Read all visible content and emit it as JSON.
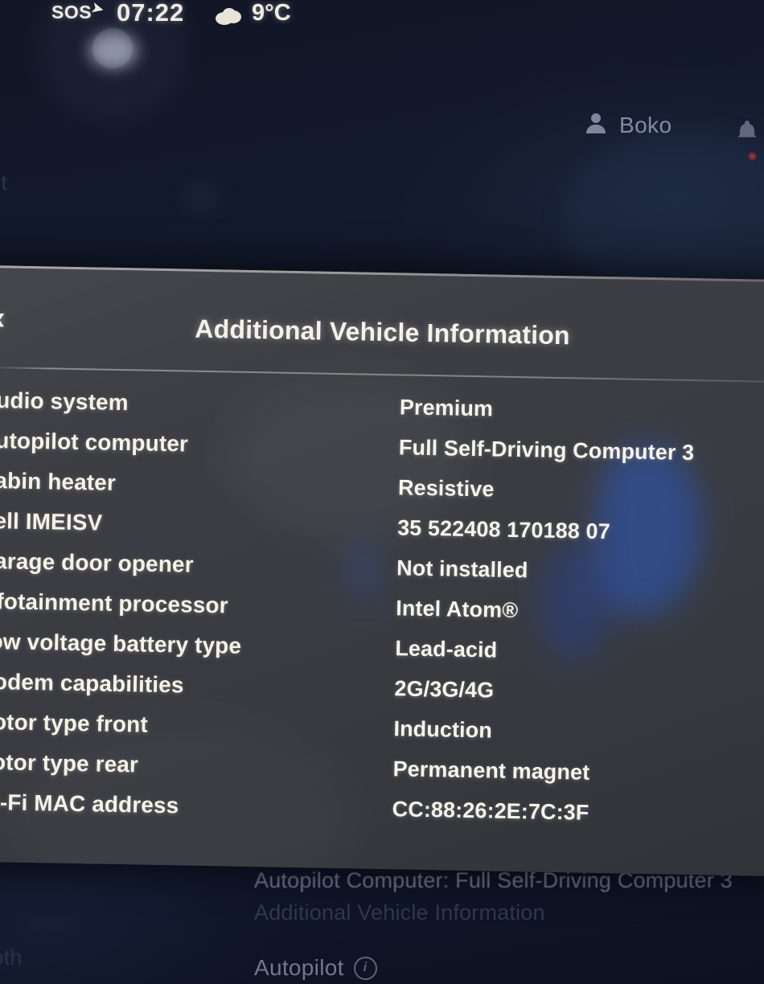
{
  "status_bar": {
    "sos_label": "SOS",
    "sos_arrow_icon": "call-arrow-icon",
    "time": "07:22",
    "weather_icon": "cloud-icon",
    "temperature": "9°C"
  },
  "profile": {
    "person_icon": "person-icon",
    "name": "Boko",
    "bell_icon": "bell-icon",
    "notification_dot": ""
  },
  "background_ghost_text": {
    "left_top": "ot",
    "left_bottom": "ooth"
  },
  "panel": {
    "back_icon": "back-chevron-icon",
    "title": "Additional Vehicle Information",
    "rows": [
      {
        "label": "Audio system",
        "value": "Premium"
      },
      {
        "label": "Autopilot computer",
        "value": "Full Self-Driving Computer 3"
      },
      {
        "label": "Cabin heater",
        "value": "Resistive"
      },
      {
        "label": "Cell IMEISV",
        "value": "35 522408 170188 07"
      },
      {
        "label": "Garage door opener",
        "value": "Not installed"
      },
      {
        "label": "Infotainment processor",
        "value": "Intel Atom®"
      },
      {
        "label": "Low voltage battery type",
        "value": "Lead-acid"
      },
      {
        "label": "Modem capabilities",
        "value": "2G/3G/4G"
      },
      {
        "label": "Motor type front",
        "value": "Induction"
      },
      {
        "label": "Motor type rear",
        "value": "Permanent magnet"
      },
      {
        "label": "Wi-Fi MAC address",
        "value": "CC:88:26:2E:7C:3F"
      }
    ]
  },
  "background_list": {
    "line1": "Autopilot Computer: Full Self-Driving Computer 3",
    "line2": "Additional Vehicle Information",
    "line3_label": "Autopilot",
    "line3_info_icon": "info-icon"
  },
  "colors": {
    "screen_bg": "#121626",
    "panel_bg": "#3a3c42",
    "text_primary": "#f7f2e4",
    "text_muted": "#8e94ad",
    "notification_red": "#9c2a3c",
    "glare_blue": "#2a5fdc"
  }
}
